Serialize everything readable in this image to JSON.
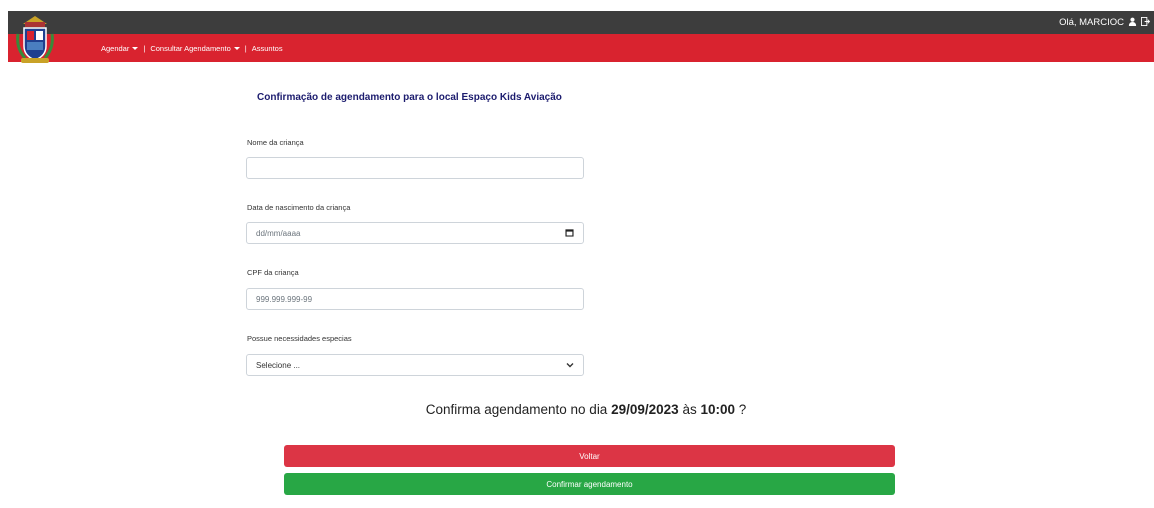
{
  "colors": {
    "topbar": "#3d3d3d",
    "brand_red": "#d9232f",
    "title_navy": "#1c1c6e",
    "danger": "#dc3545",
    "success": "#28a745"
  },
  "header": {
    "greeting": "Olá, MARCIOC",
    "user_icon": "user-icon",
    "logout_icon": "logout-icon",
    "logo_icon": "city-crest-logo"
  },
  "nav": {
    "items": [
      {
        "label": "Agendar",
        "dropdown": true
      },
      {
        "label": "Consultar Agendamento",
        "dropdown": true
      },
      {
        "label": "Assuntos",
        "dropdown": false
      }
    ],
    "separator": "|"
  },
  "form": {
    "title": "Confirmação de agendamento para o local Espaço Kids Aviação",
    "fields": {
      "child_name": {
        "label": "Nome da criança",
        "value": "",
        "placeholder": ""
      },
      "birth_date": {
        "label": "Data de nascimento da criança",
        "placeholder": "dd/mm/aaaa",
        "icon": "calendar-icon"
      },
      "cpf": {
        "label": "CPF da criança",
        "placeholder": "999.999.999-99"
      },
      "special_needs": {
        "label": "Possue necessidades especias",
        "selected": "Selecione ...",
        "icon": "chevron-down-icon"
      }
    }
  },
  "confirmation": {
    "prefix": "Confirma agendamento no dia",
    "date": "29/09/2023",
    "middle": "às",
    "time": "10:00",
    "suffix": "?"
  },
  "buttons": {
    "back": "Voltar",
    "confirm": "Confirmar agendamento"
  }
}
